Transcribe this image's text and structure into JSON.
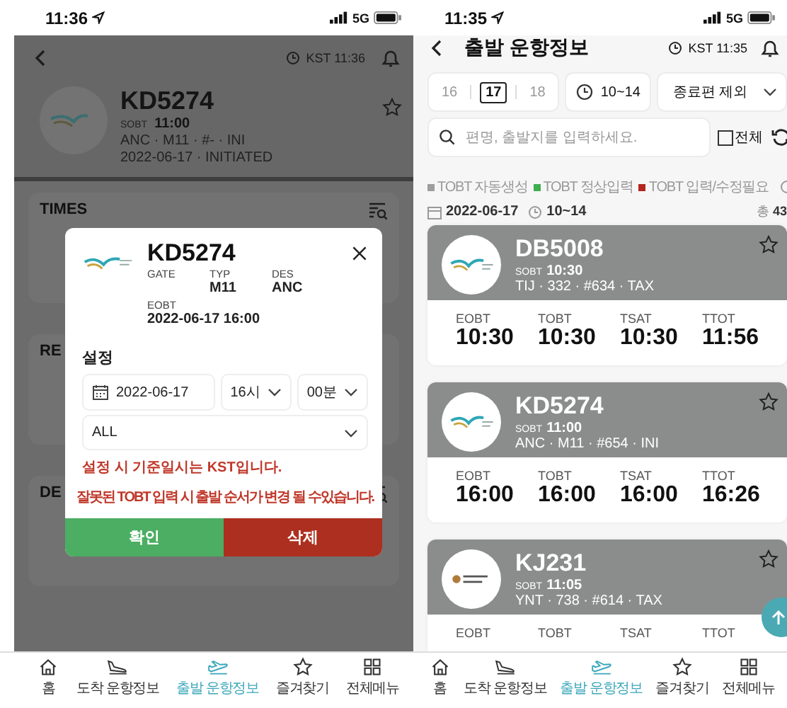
{
  "left_screen": {
    "status_bar": {
      "time": "11:36",
      "network": "5G"
    },
    "header": {
      "clock": "KST 11:36"
    },
    "flight": {
      "code": "KD5274",
      "sobt_label": "SOBT",
      "sobt": "11:00",
      "route": "ANC · M11 · #- · INI",
      "status": "2022-06-17 · INITIATED",
      "favorite": false
    },
    "sections": [
      {
        "title": "TIMES",
        "filter": true
      },
      {
        "title": "RE",
        "filter": false
      },
      {
        "title": "DE",
        "filter": true
      }
    ],
    "dialog": {
      "code": "KD5274",
      "fields": [
        {
          "label": "GATE"
        },
        {
          "label": "TYP",
          "value": "M11"
        },
        {
          "label": "DES",
          "value": "ANC"
        },
        {
          "label": "EOBT",
          "value": "2022-06-17 16:00"
        }
      ],
      "settings_title": "설정",
      "date": "2022-06-17",
      "hour": "16시",
      "minute": "00분",
      "type": "ALL",
      "notes": [
        "설정 시 기준일시는 KST입니다.",
        "잘못된 TOBT 입력 시 출발 순서가 변경 될 수있습니다."
      ],
      "buttons": [
        {
          "label": "확인",
          "kind": "confirm"
        },
        {
          "label": "삭제",
          "kind": "delete"
        }
      ]
    },
    "tab_bar": [
      {
        "label": "홈",
        "selected": false
      },
      {
        "label": "도착 운항정보",
        "selected": false
      },
      {
        "label": "출발 운항정보",
        "selected": true
      },
      {
        "label": "즐겨찾기",
        "selected": false
      },
      {
        "label": "전체메뉴",
        "selected": false
      }
    ]
  },
  "right_screen": {
    "status_bar": {
      "time": "11:35",
      "network": "5G"
    },
    "title": "출발 운항정보",
    "clock": "KST 11:35",
    "dates": [
      {
        "label": "16",
        "selected": false
      },
      {
        "label": "17",
        "selected": true
      },
      {
        "label": "18",
        "selected": false
      }
    ],
    "time_range": "10~14",
    "filter": "종료편 제외",
    "search": {
      "placeholder": "편명, 출발지를 입력하세요."
    },
    "all_toggle": {
      "label": "전체",
      "checked": false
    },
    "legend": [
      {
        "label": "TOBT 자동생성",
        "color": "#9e9e9e"
      },
      {
        "label": "TOBT 정상입력",
        "color": "#3fae4f"
      },
      {
        "label": "TOBT 입력/수정필요",
        "color": "#b3261e"
      }
    ],
    "summary": {
      "date": "2022-06-17",
      "time": "10~14",
      "total": "총 **43**"
    },
    "flights": [
      {
        "code": "DB5008",
        "kind": "swoosh",
        "sobt_label": "SOBT",
        "sobt": "10:30",
        "route": "TIJ · 332 · #634 · TAX",
        "favorite": false,
        "times": [
          {
            "label": "EOBT",
            "value": "10:30"
          },
          {
            "label": "TOBT",
            "value": "10:30"
          },
          {
            "label": "TSAT",
            "value": "10:30"
          },
          {
            "label": "TTOT",
            "value": "11:56"
          }
        ]
      },
      {
        "code": "KD5274",
        "kind": "swoosh",
        "sobt_label": "SOBT",
        "sobt": "11:00",
        "route": "ANC · M11 · #654 · INI",
        "favorite": false,
        "times": [
          {
            "label": "EOBT",
            "value": "16:00"
          },
          {
            "label": "TOBT",
            "value": "16:00"
          },
          {
            "label": "TSAT",
            "value": "16:00"
          },
          {
            "label": "TTOT",
            "value": "16:26"
          }
        ]
      },
      {
        "code": "KJ231",
        "kind": "wordmark",
        "sobt_label": "SOBT",
        "sobt": "11:05",
        "route": "YNT · 738 · #614 · TAX",
        "favorite": false,
        "times": [
          {
            "label": "EOBT"
          },
          {
            "label": "TOBT"
          },
          {
            "label": "TSAT"
          },
          {
            "label": "TTOT"
          }
        ]
      }
    ],
    "tab_bar": [
      {
        "label": "홈",
        "selected": false
      },
      {
        "label": "도착 운항정보",
        "selected": false
      },
      {
        "label": "출발 운항정보",
        "selected": true
      },
      {
        "label": "즐겨찾기",
        "selected": false
      },
      {
        "label": "전체메뉴",
        "selected": false
      }
    ]
  }
}
